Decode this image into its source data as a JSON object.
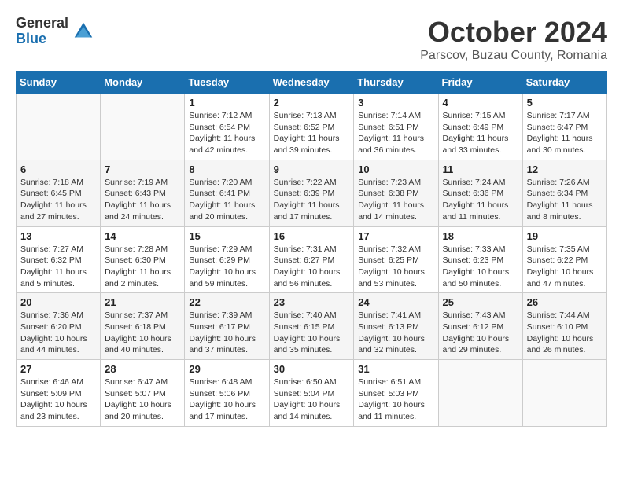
{
  "logo": {
    "general": "General",
    "blue": "Blue"
  },
  "title": "October 2024",
  "location": "Parscov, Buzau County, Romania",
  "weekdays": [
    "Sunday",
    "Monday",
    "Tuesday",
    "Wednesday",
    "Thursday",
    "Friday",
    "Saturday"
  ],
  "days": [
    {
      "date": null,
      "num": "",
      "sunrise": "",
      "sunset": "",
      "daylight": ""
    },
    {
      "date": null,
      "num": "",
      "sunrise": "",
      "sunset": "",
      "daylight": ""
    },
    {
      "num": "1",
      "sunrise": "Sunrise: 7:12 AM",
      "sunset": "Sunset: 6:54 PM",
      "daylight": "Daylight: 11 hours and 42 minutes."
    },
    {
      "num": "2",
      "sunrise": "Sunrise: 7:13 AM",
      "sunset": "Sunset: 6:52 PM",
      "daylight": "Daylight: 11 hours and 39 minutes."
    },
    {
      "num": "3",
      "sunrise": "Sunrise: 7:14 AM",
      "sunset": "Sunset: 6:51 PM",
      "daylight": "Daylight: 11 hours and 36 minutes."
    },
    {
      "num": "4",
      "sunrise": "Sunrise: 7:15 AM",
      "sunset": "Sunset: 6:49 PM",
      "daylight": "Daylight: 11 hours and 33 minutes."
    },
    {
      "num": "5",
      "sunrise": "Sunrise: 7:17 AM",
      "sunset": "Sunset: 6:47 PM",
      "daylight": "Daylight: 11 hours and 30 minutes."
    },
    {
      "num": "6",
      "sunrise": "Sunrise: 7:18 AM",
      "sunset": "Sunset: 6:45 PM",
      "daylight": "Daylight: 11 hours and 27 minutes."
    },
    {
      "num": "7",
      "sunrise": "Sunrise: 7:19 AM",
      "sunset": "Sunset: 6:43 PM",
      "daylight": "Daylight: 11 hours and 24 minutes."
    },
    {
      "num": "8",
      "sunrise": "Sunrise: 7:20 AM",
      "sunset": "Sunset: 6:41 PM",
      "daylight": "Daylight: 11 hours and 20 minutes."
    },
    {
      "num": "9",
      "sunrise": "Sunrise: 7:22 AM",
      "sunset": "Sunset: 6:39 PM",
      "daylight": "Daylight: 11 hours and 17 minutes."
    },
    {
      "num": "10",
      "sunrise": "Sunrise: 7:23 AM",
      "sunset": "Sunset: 6:38 PM",
      "daylight": "Daylight: 11 hours and 14 minutes."
    },
    {
      "num": "11",
      "sunrise": "Sunrise: 7:24 AM",
      "sunset": "Sunset: 6:36 PM",
      "daylight": "Daylight: 11 hours and 11 minutes."
    },
    {
      "num": "12",
      "sunrise": "Sunrise: 7:26 AM",
      "sunset": "Sunset: 6:34 PM",
      "daylight": "Daylight: 11 hours and 8 minutes."
    },
    {
      "num": "13",
      "sunrise": "Sunrise: 7:27 AM",
      "sunset": "Sunset: 6:32 PM",
      "daylight": "Daylight: 11 hours and 5 minutes."
    },
    {
      "num": "14",
      "sunrise": "Sunrise: 7:28 AM",
      "sunset": "Sunset: 6:30 PM",
      "daylight": "Daylight: 11 hours and 2 minutes."
    },
    {
      "num": "15",
      "sunrise": "Sunrise: 7:29 AM",
      "sunset": "Sunset: 6:29 PM",
      "daylight": "Daylight: 10 hours and 59 minutes."
    },
    {
      "num": "16",
      "sunrise": "Sunrise: 7:31 AM",
      "sunset": "Sunset: 6:27 PM",
      "daylight": "Daylight: 10 hours and 56 minutes."
    },
    {
      "num": "17",
      "sunrise": "Sunrise: 7:32 AM",
      "sunset": "Sunset: 6:25 PM",
      "daylight": "Daylight: 10 hours and 53 minutes."
    },
    {
      "num": "18",
      "sunrise": "Sunrise: 7:33 AM",
      "sunset": "Sunset: 6:23 PM",
      "daylight": "Daylight: 10 hours and 50 minutes."
    },
    {
      "num": "19",
      "sunrise": "Sunrise: 7:35 AM",
      "sunset": "Sunset: 6:22 PM",
      "daylight": "Daylight: 10 hours and 47 minutes."
    },
    {
      "num": "20",
      "sunrise": "Sunrise: 7:36 AM",
      "sunset": "Sunset: 6:20 PM",
      "daylight": "Daylight: 10 hours and 44 minutes."
    },
    {
      "num": "21",
      "sunrise": "Sunrise: 7:37 AM",
      "sunset": "Sunset: 6:18 PM",
      "daylight": "Daylight: 10 hours and 40 minutes."
    },
    {
      "num": "22",
      "sunrise": "Sunrise: 7:39 AM",
      "sunset": "Sunset: 6:17 PM",
      "daylight": "Daylight: 10 hours and 37 minutes."
    },
    {
      "num": "23",
      "sunrise": "Sunrise: 7:40 AM",
      "sunset": "Sunset: 6:15 PM",
      "daylight": "Daylight: 10 hours and 35 minutes."
    },
    {
      "num": "24",
      "sunrise": "Sunrise: 7:41 AM",
      "sunset": "Sunset: 6:13 PM",
      "daylight": "Daylight: 10 hours and 32 minutes."
    },
    {
      "num": "25",
      "sunrise": "Sunrise: 7:43 AM",
      "sunset": "Sunset: 6:12 PM",
      "daylight": "Daylight: 10 hours and 29 minutes."
    },
    {
      "num": "26",
      "sunrise": "Sunrise: 7:44 AM",
      "sunset": "Sunset: 6:10 PM",
      "daylight": "Daylight: 10 hours and 26 minutes."
    },
    {
      "num": "27",
      "sunrise": "Sunrise: 6:46 AM",
      "sunset": "Sunset: 5:09 PM",
      "daylight": "Daylight: 10 hours and 23 minutes."
    },
    {
      "num": "28",
      "sunrise": "Sunrise: 6:47 AM",
      "sunset": "Sunset: 5:07 PM",
      "daylight": "Daylight: 10 hours and 20 minutes."
    },
    {
      "num": "29",
      "sunrise": "Sunrise: 6:48 AM",
      "sunset": "Sunset: 5:06 PM",
      "daylight": "Daylight: 10 hours and 17 minutes."
    },
    {
      "num": "30",
      "sunrise": "Sunrise: 6:50 AM",
      "sunset": "Sunset: 5:04 PM",
      "daylight": "Daylight: 10 hours and 14 minutes."
    },
    {
      "num": "31",
      "sunrise": "Sunrise: 6:51 AM",
      "sunset": "Sunset: 5:03 PM",
      "daylight": "Daylight: 10 hours and 11 minutes."
    },
    {
      "date": null,
      "num": "",
      "sunrise": "",
      "sunset": "",
      "daylight": ""
    },
    {
      "date": null,
      "num": "",
      "sunrise": "",
      "sunset": "",
      "daylight": ""
    }
  ]
}
